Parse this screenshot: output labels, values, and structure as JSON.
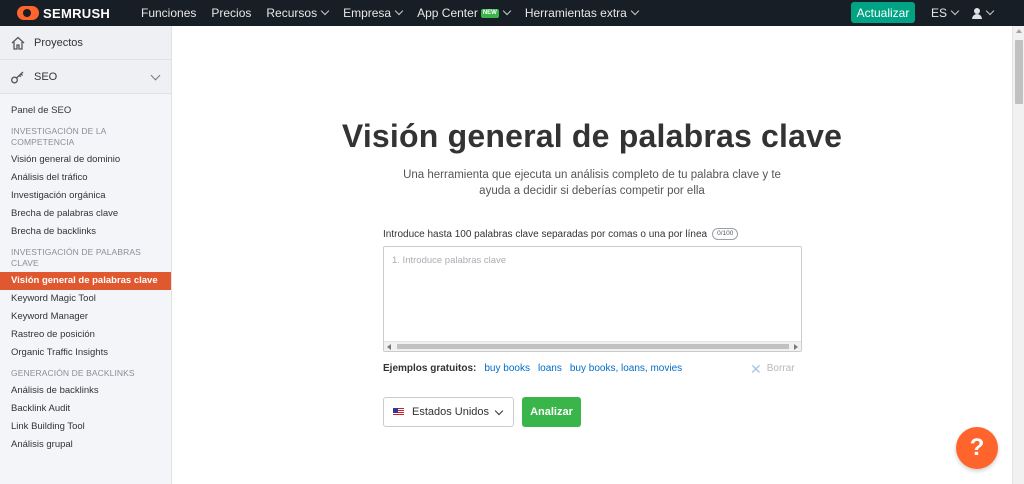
{
  "brand": {
    "name": "SEMRUSH",
    "accent": "#ff642d"
  },
  "topnav": {
    "items": [
      {
        "label": "Funciones",
        "has_chevron": false
      },
      {
        "label": "Precios",
        "has_chevron": false
      },
      {
        "label": "Recursos",
        "has_chevron": true
      },
      {
        "label": "Empresa",
        "has_chevron": true
      },
      {
        "label": "App Center",
        "has_chevron": true,
        "badge": "NEW"
      },
      {
        "label": "Herramientas extra",
        "has_chevron": true
      }
    ],
    "upgrade_label": "Actualizar",
    "upgrade_color": "#00a383",
    "language": "ES",
    "user_icon": "user-icon"
  },
  "sidebar": {
    "projects_label": "Proyectos",
    "projects_icon": "home-icon",
    "seo_label": "SEO",
    "seo_icon": "key-icon",
    "panel_label": "Panel de SEO",
    "sections": [
      {
        "title": "INVESTIGACIÓN DE LA COMPETENCIA",
        "items": [
          "Visión general de dominio",
          "Análisis del tráfico",
          "Investigación orgánica",
          "Brecha de palabras clave",
          "Brecha de backlinks"
        ]
      },
      {
        "title": "INVESTIGACIÓN DE PALABRAS CLAVE",
        "items": [
          "Visión general de palabras clave",
          "Keyword Magic Tool",
          "Keyword Manager",
          "Rastreo de posición",
          "Organic Traffic Insights"
        ]
      },
      {
        "title": "GENERACIÓN DE BACKLINKS",
        "items": [
          "Análisis de backlinks",
          "Backlink Audit",
          "Link Building Tool",
          "Análisis grupal"
        ]
      }
    ],
    "active_item": "Visión general de palabras clave",
    "active_color": "#e0582f"
  },
  "main": {
    "title": "Visión general de palabras clave",
    "subtitle": "Una herramienta que ejecuta un análisis completo de tu palabra clave y te ayuda a decidir si deberías competir por ella",
    "input_label": "Introduce hasta 100 palabras clave separadas por comas o una por línea",
    "counter": "0/100",
    "placeholder": "1. Introduce palabras clave",
    "examples_label": "Ejemplos gratuitos:",
    "examples": [
      "buy books",
      "loans",
      "buy books, loans, movies"
    ],
    "clear_label": "Borrar",
    "country": "Estados Unidos",
    "analyze_label": "Analizar",
    "analyze_color": "#3ab54a",
    "help_label": "?"
  }
}
